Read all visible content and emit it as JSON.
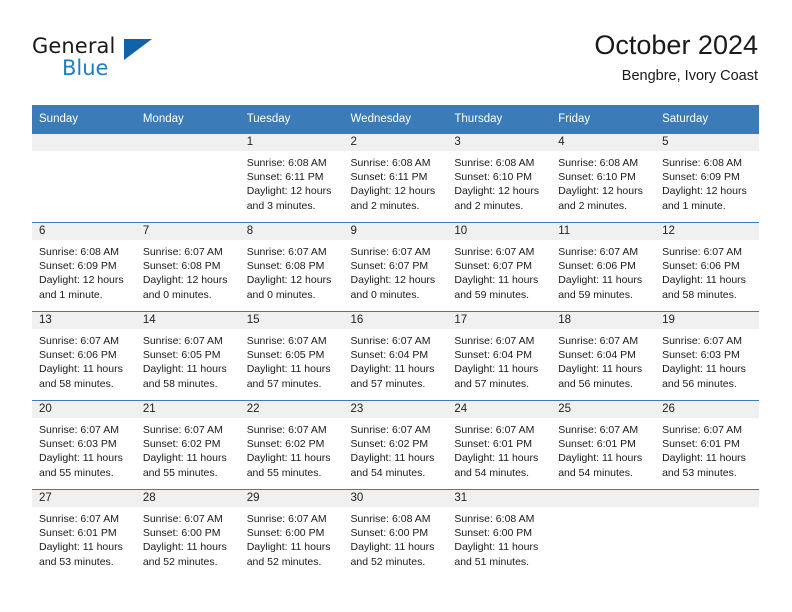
{
  "logo": {
    "text_top": "General",
    "text_bottom": "Blue",
    "triangle_color": "#1063a8",
    "blue_color": "#1c7fc4"
  },
  "header": {
    "title": "October 2024",
    "subtitle": "Bengbre, Ivory Coast"
  },
  "theme": {
    "header_bg": "#3b7cb8",
    "header_text": "#ffffff",
    "daynum_band_bg": "#f0f0f0",
    "cell_bg": "#ffffff",
    "row_border": "#3b7cb8"
  },
  "weekdays": [
    "Sunday",
    "Monday",
    "Tuesday",
    "Wednesday",
    "Thursday",
    "Friday",
    "Saturday"
  ],
  "labels": {
    "sunrise_prefix": "Sunrise:",
    "sunset_prefix": "Sunset:",
    "daylight_prefix": "Daylight:"
  },
  "weeks": [
    [
      {
        "blank": true
      },
      {
        "blank": true
      },
      {
        "day": "1",
        "sunrise": "Sunrise: 6:08 AM",
        "sunset": "Sunset: 6:11 PM",
        "daylight1": "Daylight: 12 hours",
        "daylight2": "and 3 minutes."
      },
      {
        "day": "2",
        "sunrise": "Sunrise: 6:08 AM",
        "sunset": "Sunset: 6:11 PM",
        "daylight1": "Daylight: 12 hours",
        "daylight2": "and 2 minutes."
      },
      {
        "day": "3",
        "sunrise": "Sunrise: 6:08 AM",
        "sunset": "Sunset: 6:10 PM",
        "daylight1": "Daylight: 12 hours",
        "daylight2": "and 2 minutes."
      },
      {
        "day": "4",
        "sunrise": "Sunrise: 6:08 AM",
        "sunset": "Sunset: 6:10 PM",
        "daylight1": "Daylight: 12 hours",
        "daylight2": "and 2 minutes."
      },
      {
        "day": "5",
        "sunrise": "Sunrise: 6:08 AM",
        "sunset": "Sunset: 6:09 PM",
        "daylight1": "Daylight: 12 hours",
        "daylight2": "and 1 minute."
      }
    ],
    [
      {
        "day": "6",
        "sunrise": "Sunrise: 6:08 AM",
        "sunset": "Sunset: 6:09 PM",
        "daylight1": "Daylight: 12 hours",
        "daylight2": "and 1 minute."
      },
      {
        "day": "7",
        "sunrise": "Sunrise: 6:07 AM",
        "sunset": "Sunset: 6:08 PM",
        "daylight1": "Daylight: 12 hours",
        "daylight2": "and 0 minutes."
      },
      {
        "day": "8",
        "sunrise": "Sunrise: 6:07 AM",
        "sunset": "Sunset: 6:08 PM",
        "daylight1": "Daylight: 12 hours",
        "daylight2": "and 0 minutes."
      },
      {
        "day": "9",
        "sunrise": "Sunrise: 6:07 AM",
        "sunset": "Sunset: 6:07 PM",
        "daylight1": "Daylight: 12 hours",
        "daylight2": "and 0 minutes."
      },
      {
        "day": "10",
        "sunrise": "Sunrise: 6:07 AM",
        "sunset": "Sunset: 6:07 PM",
        "daylight1": "Daylight: 11 hours",
        "daylight2": "and 59 minutes."
      },
      {
        "day": "11",
        "sunrise": "Sunrise: 6:07 AM",
        "sunset": "Sunset: 6:06 PM",
        "daylight1": "Daylight: 11 hours",
        "daylight2": "and 59 minutes."
      },
      {
        "day": "12",
        "sunrise": "Sunrise: 6:07 AM",
        "sunset": "Sunset: 6:06 PM",
        "daylight1": "Daylight: 11 hours",
        "daylight2": "and 58 minutes."
      }
    ],
    [
      {
        "day": "13",
        "sunrise": "Sunrise: 6:07 AM",
        "sunset": "Sunset: 6:06 PM",
        "daylight1": "Daylight: 11 hours",
        "daylight2": "and 58 minutes."
      },
      {
        "day": "14",
        "sunrise": "Sunrise: 6:07 AM",
        "sunset": "Sunset: 6:05 PM",
        "daylight1": "Daylight: 11 hours",
        "daylight2": "and 58 minutes."
      },
      {
        "day": "15",
        "sunrise": "Sunrise: 6:07 AM",
        "sunset": "Sunset: 6:05 PM",
        "daylight1": "Daylight: 11 hours",
        "daylight2": "and 57 minutes."
      },
      {
        "day": "16",
        "sunrise": "Sunrise: 6:07 AM",
        "sunset": "Sunset: 6:04 PM",
        "daylight1": "Daylight: 11 hours",
        "daylight2": "and 57 minutes."
      },
      {
        "day": "17",
        "sunrise": "Sunrise: 6:07 AM",
        "sunset": "Sunset: 6:04 PM",
        "daylight1": "Daylight: 11 hours",
        "daylight2": "and 57 minutes."
      },
      {
        "day": "18",
        "sunrise": "Sunrise: 6:07 AM",
        "sunset": "Sunset: 6:04 PM",
        "daylight1": "Daylight: 11 hours",
        "daylight2": "and 56 minutes."
      },
      {
        "day": "19",
        "sunrise": "Sunrise: 6:07 AM",
        "sunset": "Sunset: 6:03 PM",
        "daylight1": "Daylight: 11 hours",
        "daylight2": "and 56 minutes."
      }
    ],
    [
      {
        "day": "20",
        "sunrise": "Sunrise: 6:07 AM",
        "sunset": "Sunset: 6:03 PM",
        "daylight1": "Daylight: 11 hours",
        "daylight2": "and 55 minutes."
      },
      {
        "day": "21",
        "sunrise": "Sunrise: 6:07 AM",
        "sunset": "Sunset: 6:02 PM",
        "daylight1": "Daylight: 11 hours",
        "daylight2": "and 55 minutes."
      },
      {
        "day": "22",
        "sunrise": "Sunrise: 6:07 AM",
        "sunset": "Sunset: 6:02 PM",
        "daylight1": "Daylight: 11 hours",
        "daylight2": "and 55 minutes."
      },
      {
        "day": "23",
        "sunrise": "Sunrise: 6:07 AM",
        "sunset": "Sunset: 6:02 PM",
        "daylight1": "Daylight: 11 hours",
        "daylight2": "and 54 minutes."
      },
      {
        "day": "24",
        "sunrise": "Sunrise: 6:07 AM",
        "sunset": "Sunset: 6:01 PM",
        "daylight1": "Daylight: 11 hours",
        "daylight2": "and 54 minutes."
      },
      {
        "day": "25",
        "sunrise": "Sunrise: 6:07 AM",
        "sunset": "Sunset: 6:01 PM",
        "daylight1": "Daylight: 11 hours",
        "daylight2": "and 54 minutes."
      },
      {
        "day": "26",
        "sunrise": "Sunrise: 6:07 AM",
        "sunset": "Sunset: 6:01 PM",
        "daylight1": "Daylight: 11 hours",
        "daylight2": "and 53 minutes."
      }
    ],
    [
      {
        "day": "27",
        "sunrise": "Sunrise: 6:07 AM",
        "sunset": "Sunset: 6:01 PM",
        "daylight1": "Daylight: 11 hours",
        "daylight2": "and 53 minutes."
      },
      {
        "day": "28",
        "sunrise": "Sunrise: 6:07 AM",
        "sunset": "Sunset: 6:00 PM",
        "daylight1": "Daylight: 11 hours",
        "daylight2": "and 52 minutes."
      },
      {
        "day": "29",
        "sunrise": "Sunrise: 6:07 AM",
        "sunset": "Sunset: 6:00 PM",
        "daylight1": "Daylight: 11 hours",
        "daylight2": "and 52 minutes."
      },
      {
        "day": "30",
        "sunrise": "Sunrise: 6:08 AM",
        "sunset": "Sunset: 6:00 PM",
        "daylight1": "Daylight: 11 hours",
        "daylight2": "and 52 minutes."
      },
      {
        "day": "31",
        "sunrise": "Sunrise: 6:08 AM",
        "sunset": "Sunset: 6:00 PM",
        "daylight1": "Daylight: 11 hours",
        "daylight2": "and 51 minutes."
      },
      {
        "blank": true
      },
      {
        "blank": true
      }
    ]
  ]
}
